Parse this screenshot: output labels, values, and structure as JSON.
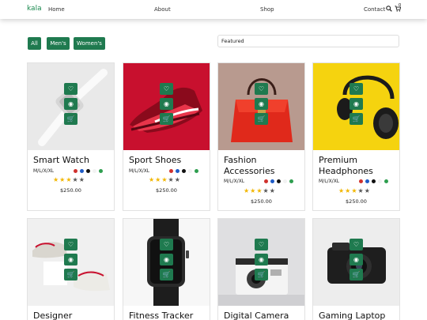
{
  "nav": {
    "logo": "kala",
    "links": [
      "Home",
      "About",
      "Shop",
      "Contact"
    ],
    "cart_count": "0"
  },
  "filters": [
    "All",
    "Men's",
    "Women's"
  ],
  "sort": {
    "selected": "Featured"
  },
  "colors": {
    "accent": "#1f7a4f",
    "star": "#f2b600"
  },
  "swatch_colors": [
    "#d0312d",
    "#1e5bc6",
    "#111111",
    "#f2f2f2",
    "#2e9e4f"
  ],
  "products": [
    {
      "name": "Smart Watch",
      "sizes": "M/L/X/XL",
      "rating": 3,
      "price": "$250.00"
    },
    {
      "name": "Sport Shoes",
      "sizes": "M/L/X/XL",
      "rating": 3,
      "price": "$250.00"
    },
    {
      "name": "Fashion Accessories",
      "sizes": "M/L/X/XL",
      "rating": 3,
      "price": "$250.00"
    },
    {
      "name": "Premium Headphones",
      "sizes": "M/L/X/XL",
      "rating": 3,
      "price": "$250.00"
    },
    {
      "name": "Designer",
      "sizes": "",
      "rating": 0,
      "price": ""
    },
    {
      "name": "Fitness Tracker",
      "sizes": "",
      "rating": 0,
      "price": ""
    },
    {
      "name": "Digital Camera",
      "sizes": "",
      "rating": 0,
      "price": ""
    },
    {
      "name": "Gaming Laptop",
      "sizes": "",
      "rating": 0,
      "price": ""
    }
  ],
  "action_icons": [
    "heart-icon",
    "eye-icon",
    "cart-icon"
  ]
}
